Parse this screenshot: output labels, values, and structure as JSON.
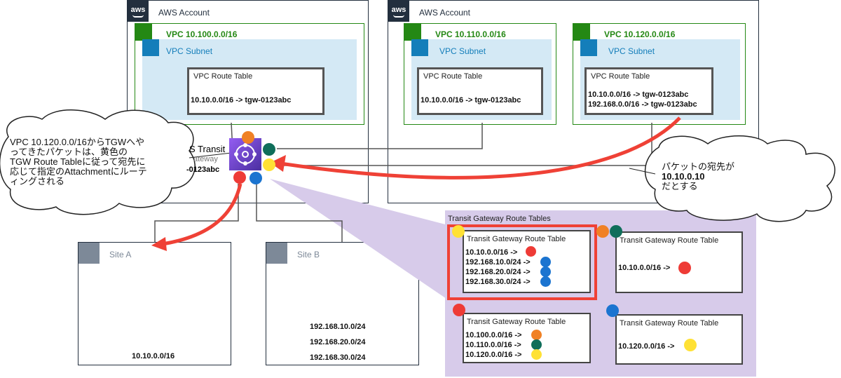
{
  "accounts": [
    {
      "logo": "aws",
      "title": "AWS Account"
    },
    {
      "logo": "aws",
      "title": "AWS Account"
    }
  ],
  "vpcs": [
    {
      "title": "VPC 10.100.0.0/16",
      "subnet": "VPC Subnet",
      "rt_title": "VPC Route Table",
      "routes": [
        "10.10.0.0/16 -> tgw-0123abc"
      ]
    },
    {
      "title": "VPC 10.110.0.0/16",
      "subnet": "VPC Subnet",
      "rt_title": "VPC Route Table",
      "routes": [
        "10.10.0.0/16 -> tgw-0123abc"
      ]
    },
    {
      "title": "VPC 10.120.0.0/16",
      "subnet": "VPC Subnet",
      "rt_title": "VPC Route Table",
      "routes": [
        "10.10.0.0/16 -> tgw-0123abc",
        "192.168.0.0/16 -> tgw-0123abc"
      ]
    }
  ],
  "tgw": {
    "label1": "S Transit",
    "label2": "ateway",
    "label3": "-0123abc"
  },
  "left_bubble": {
    "lines": [
      "VPC 10.120.0.0/16からTGWへや",
      "ってきたパケットは、黄色の",
      "TGW Route Tableに従って宛先に",
      "応じて指定のAttachmentにルーテ",
      "ィングされる"
    ]
  },
  "right_bubble": {
    "line1": "パケットの宛先が",
    "line2": "10.10.0.10",
    "line3": "だとする"
  },
  "sites": [
    {
      "title": "Site A",
      "cidrs": [
        "10.10.0.0/16"
      ]
    },
    {
      "title": "Site B",
      "cidrs": [
        "192.168.10.0/24",
        "192.168.20.0/24",
        "192.168.30.0/24"
      ]
    }
  ],
  "route_tables_panel": {
    "title": "Transit Gateway Route Tables",
    "tables": [
      {
        "title": "Transit Gateway Route Table",
        "routes": [
          "10.10.0.0/16 ->",
          "192.168.10.0/24 ->",
          "192.168.20.0/24 ->",
          "192.168.30.0/24 ->"
        ]
      },
      {
        "title": "Transit Gateway Route Table",
        "routes": [
          "10.10.0.0/16 ->"
        ]
      },
      {
        "title": "Transit Gateway Route Table",
        "routes": [
          "10.100.0.0/16 ->",
          "10.110.0.0/16 ->",
          "10.120.0.0/16 ->"
        ]
      },
      {
        "title": "Transit Gateway Route Table",
        "routes": [
          "10.120.0.0/16 ->"
        ]
      }
    ]
  },
  "colors": {
    "orange": "#f08125",
    "green": "#0f6e5a",
    "yellow": "#ffe135",
    "red": "#ee3b36",
    "blue": "#1b74d0",
    "purple": "#d7cbea",
    "arrow": "#ef4136"
  }
}
